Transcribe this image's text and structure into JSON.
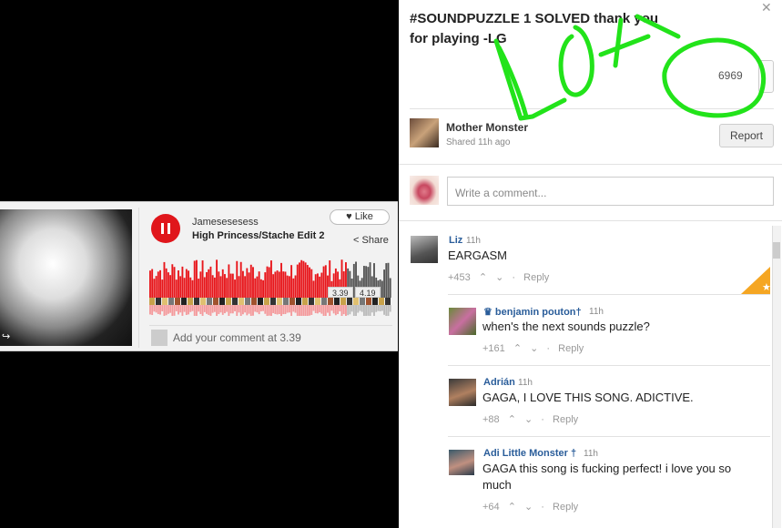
{
  "player": {
    "uploader": "Jamesesesess",
    "track_title": "High Princess/Stache Edit 2",
    "like_label": "Like",
    "share_label": "Share",
    "current_time": "3.39",
    "duration": "4.19",
    "comment_placeholder": "Add your comment at 3.39",
    "progress": 0.81
  },
  "post": {
    "title": "#SOUNDPUZZLE 1 SOLVED thank you for playing -LG",
    "vote_count": "6969",
    "poster_name": "Mother Monster",
    "poster_meta": "Shared 11h ago",
    "report_label": "Report",
    "write_placeholder": "Write a comment..."
  },
  "comments": [
    {
      "name": "Liz",
      "time": "11h",
      "text": "EARGASM",
      "votes": "+453",
      "reply": "Reply"
    },
    {
      "name": "♛ benjamin pouton†",
      "time": "11h",
      "text": "when's the next sounds puzzle?",
      "votes": "+161",
      "reply": "Reply"
    },
    {
      "name": "Adrián",
      "time": "11h",
      "text": "GAGA, I LOVE THIS SONG. ADICTIVE.",
      "votes": "+88",
      "reply": "Reply"
    },
    {
      "name": "Adi Little Monster †",
      "time": "11h",
      "text": "GAGA this song is fucking perfect! i love you so much",
      "votes": "+64",
      "reply": "Reply"
    }
  ],
  "colors": {
    "accent_red": "#e0161b",
    "link_blue": "#2a5d9a",
    "scribble_green": "#22e31a",
    "badge_orange": "#f5a623"
  },
  "icons": {
    "play_pause": "pause-icon",
    "like": "heart-icon",
    "share": "share-icon",
    "report": "flag-icon"
  }
}
